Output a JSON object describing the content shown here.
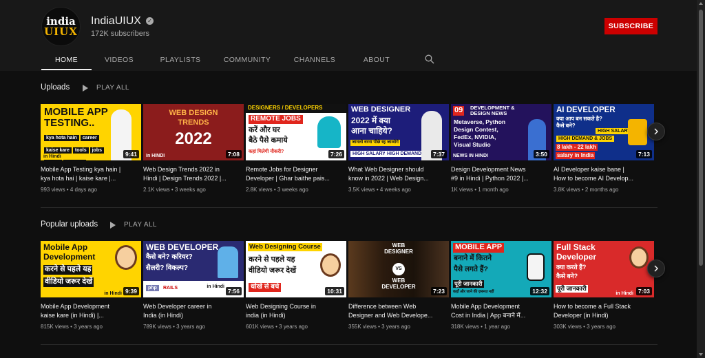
{
  "channel": {
    "avatar_line1": "india",
    "avatar_line2": "UIUX",
    "name": "IndiaUIUX",
    "verified_glyph": "✓",
    "subscribers": "172K subscribers",
    "subscribe_label": "SUBSCRIBE"
  },
  "tabs": [
    {
      "label": "HOME",
      "active": true
    },
    {
      "label": "VIDEOS"
    },
    {
      "label": "PLAYLISTS"
    },
    {
      "label": "COMMUNITY"
    },
    {
      "label": "CHANNELS"
    },
    {
      "label": "ABOUT"
    }
  ],
  "icons": {
    "search": "search-icon",
    "next": "chevron-right-icon",
    "play": "play-icon"
  },
  "colors": {
    "accent": "#cc0000",
    "background": "#0f0f0f",
    "header": "#181818"
  },
  "shelves": [
    {
      "title": "Uploads",
      "play_all": "PLAY ALL",
      "videos": [
        {
          "title": "Mobile App Testing kya hain |\nkya hota hai | kaise kare |...",
          "meta": "993 views • 4 days ago",
          "duration": "9:41",
          "thumb_lines": [
            "MOBILE APP",
            "TESTING..",
            "kya hota hain",
            "career",
            "kaise kare",
            "tools",
            "jobs",
            "salary",
            "courses",
            "in Hindi"
          ]
        },
        {
          "title": "Web Design Trends 2022 in\nHindi | Design Trends 2022 |...",
          "meta": "2.1K views • 3 weeks ago",
          "duration": "7:08",
          "thumb_lines": [
            "WEB DESIGN",
            "TRENDS",
            "2022",
            "in HINDI"
          ]
        },
        {
          "title": "Remote Jobs for Designer\nDeveloper | Ghar baithe pais...",
          "meta": "2.8K views • 3 weeks ago",
          "duration": "7:26",
          "thumb_lines": [
            "DESIGNERS / DEVELOPERS",
            "REMOTE JOBS",
            "करें और घर",
            "बैठे पैसे कमाये",
            "कहां मिलेगी नौकरी?"
          ]
        },
        {
          "title": "What Web Designer should\nknow in 2022 | Web Design...",
          "meta": "3.5K views • 4 weeks ago",
          "duration": "7:37",
          "thumb_lines": [
            "WEB DESIGNER",
            "2022 में क्या",
            "आना चाहिये?",
            "जानलो वरना पीछे रह जाओगे",
            "HIGH SALARY",
            "HIGH DEMAND"
          ]
        },
        {
          "title": "Design Development News\n#9 in Hindi | Python 2022 |...",
          "meta": "1K views • 1 month ago",
          "duration": "3:50",
          "thumb_lines": [
            "09",
            "DEVELOPMENT &",
            "DESIGN NEWS",
            "Metaverse, Python",
            "Design Contest,",
            "FedEx, NVIDIA,",
            "Visual Studio",
            "NEWS IN HINDI"
          ]
        },
        {
          "title": "AI Developer kaise bane |\nHow to become AI Develop...",
          "meta": "3.8K views • 2 months ago",
          "duration": "7:13",
          "thumb_lines": [
            "AI DEVELOPER",
            "क्या आप बन सकते है?",
            "कैसे बने?",
            "HIGH SALARY",
            "HIGH DEMAND & JOBS",
            "8 lakh - 22 lakh",
            "salary in India"
          ]
        }
      ]
    },
    {
      "title": "Popular uploads",
      "play_all": "PLAY ALL",
      "videos": [
        {
          "title": "Mobile App Development\nkaise kare (in Hindi) |...",
          "meta": "815K views • 3 years ago",
          "duration": "9:39",
          "thumb_lines": [
            "Mobile App",
            "Development",
            "करने से पहले यह",
            "वीडियो जरूर देखें",
            "in Hindi"
          ]
        },
        {
          "title": "Web Developer career in\nIndia (in Hindi)",
          "meta": "789K views • 3 years ago",
          "duration": "7:56",
          "thumb_lines": [
            "WEB DEVELOPER",
            "कैसे बने? करियर?",
            "सैलरी? विकल्प?",
            "php",
            "RAILS",
            "in Hindi"
          ]
        },
        {
          "title": "Web Designing Course in\nindia (in Hindi)",
          "meta": "601K views • 3 years ago",
          "duration": "10:31",
          "thumb_lines": [
            "Web Designing Course",
            "करने से पहले यह",
            "वीडियो जरूर देखें",
            "धोखे से बचे"
          ]
        },
        {
          "title": "Difference between Web\nDesigner and Web Develope...",
          "meta": "355K views • 3 years ago",
          "duration": "7:23",
          "thumb_lines": [
            "WEB",
            "DESIGNER",
            "VS",
            "WEB",
            "DEVELOPER"
          ]
        },
        {
          "title": "Mobile App Development\nCost in India | App बनाने में...",
          "meta": "318K views • 1 year ago",
          "duration": "12:32",
          "thumb_lines": [
            "MOBILE APP",
            "बनाने में कितने",
            "पैसे लगते हैं?",
            "पूरी जानकारी",
            "कहाँ और जाने की ज़रूरत नहीं"
          ]
        },
        {
          "title": "How to become a Full Stack\nDeveloper (in Hindi)",
          "meta": "303K views • 3 years ago",
          "duration": "7:03",
          "thumb_lines": [
            "Full Stack",
            "Developer",
            "क्या करते हैं?",
            "कैसे बने?",
            "पूरी जानकारी",
            "in Hindi"
          ]
        }
      ]
    }
  ]
}
